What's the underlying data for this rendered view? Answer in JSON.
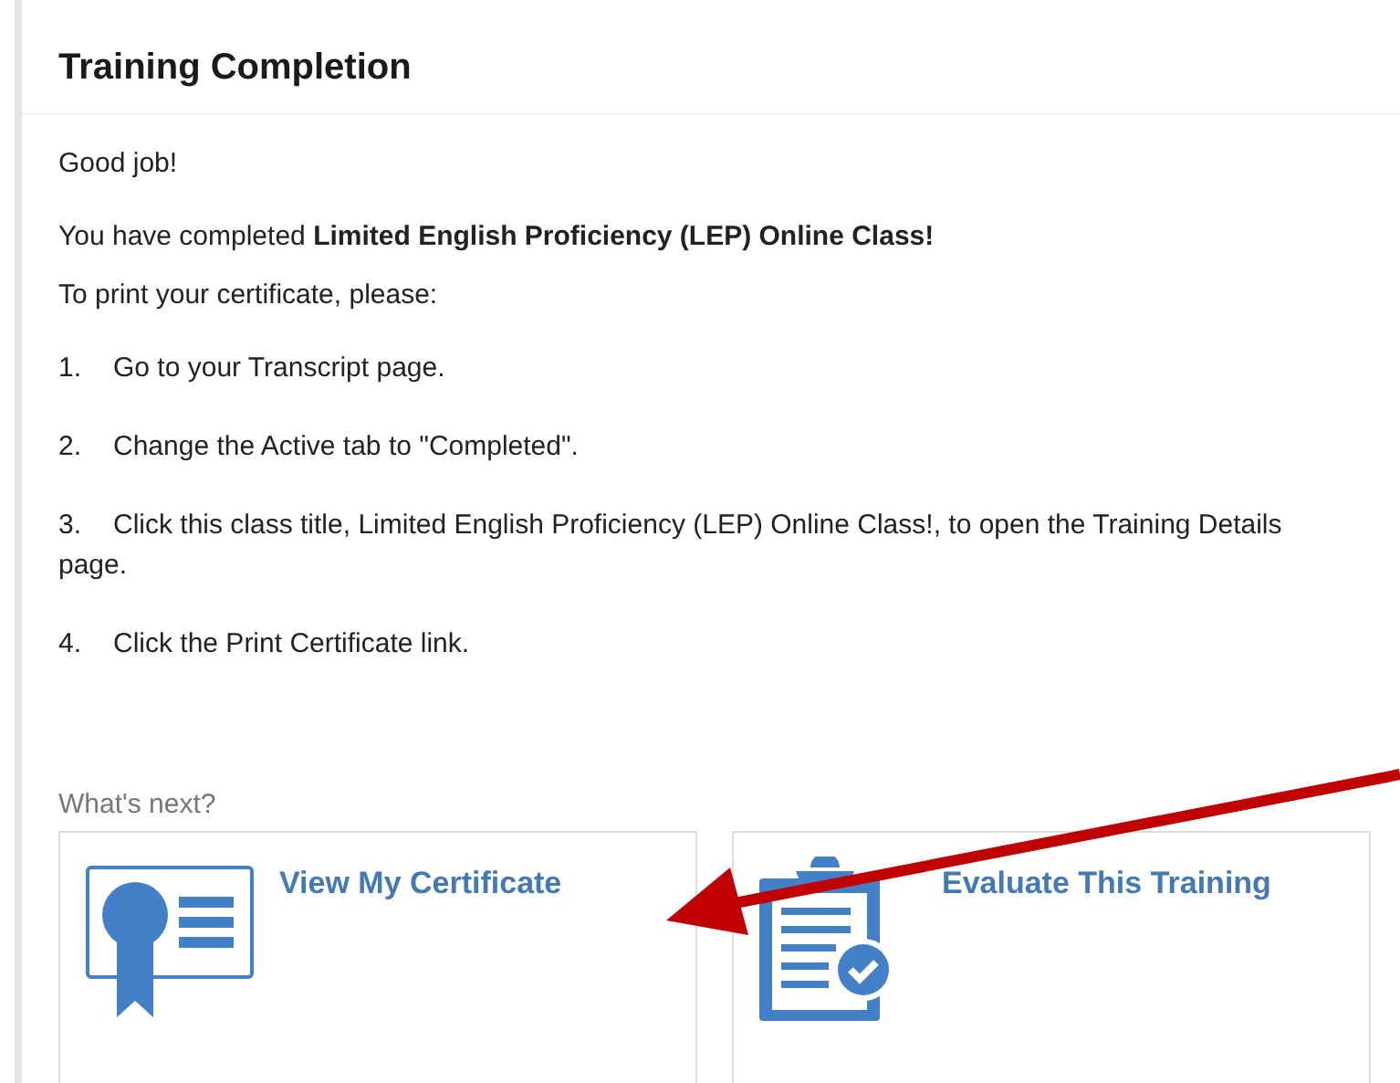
{
  "panel": {
    "title": "Training Completion"
  },
  "messages": [
    "Good job!",
    "You have completed **Limited English Proficiency (LEP) Online Class!**",
    "To print your certificate, please:"
  ],
  "steps": [
    {
      "number": "1.",
      "text": "Go to your Transcript page."
    },
    {
      "number": "2.",
      "text": "Change the Active tab to \"Completed\"."
    },
    {
      "number": "3.",
      "text": "Click this class title, Limited English Proficiency (LEP) Online Class!, to open the Training Details page."
    },
    {
      "number": "4.",
      "text": "Click the Print Certificate link."
    }
  ],
  "next": {
    "label": "What's next?",
    "cards": [
      {
        "kind": "certificate",
        "title": "View My Certificate"
      },
      {
        "kind": "evaluation",
        "title": "Evaluate This Training"
      }
    ]
  }
}
